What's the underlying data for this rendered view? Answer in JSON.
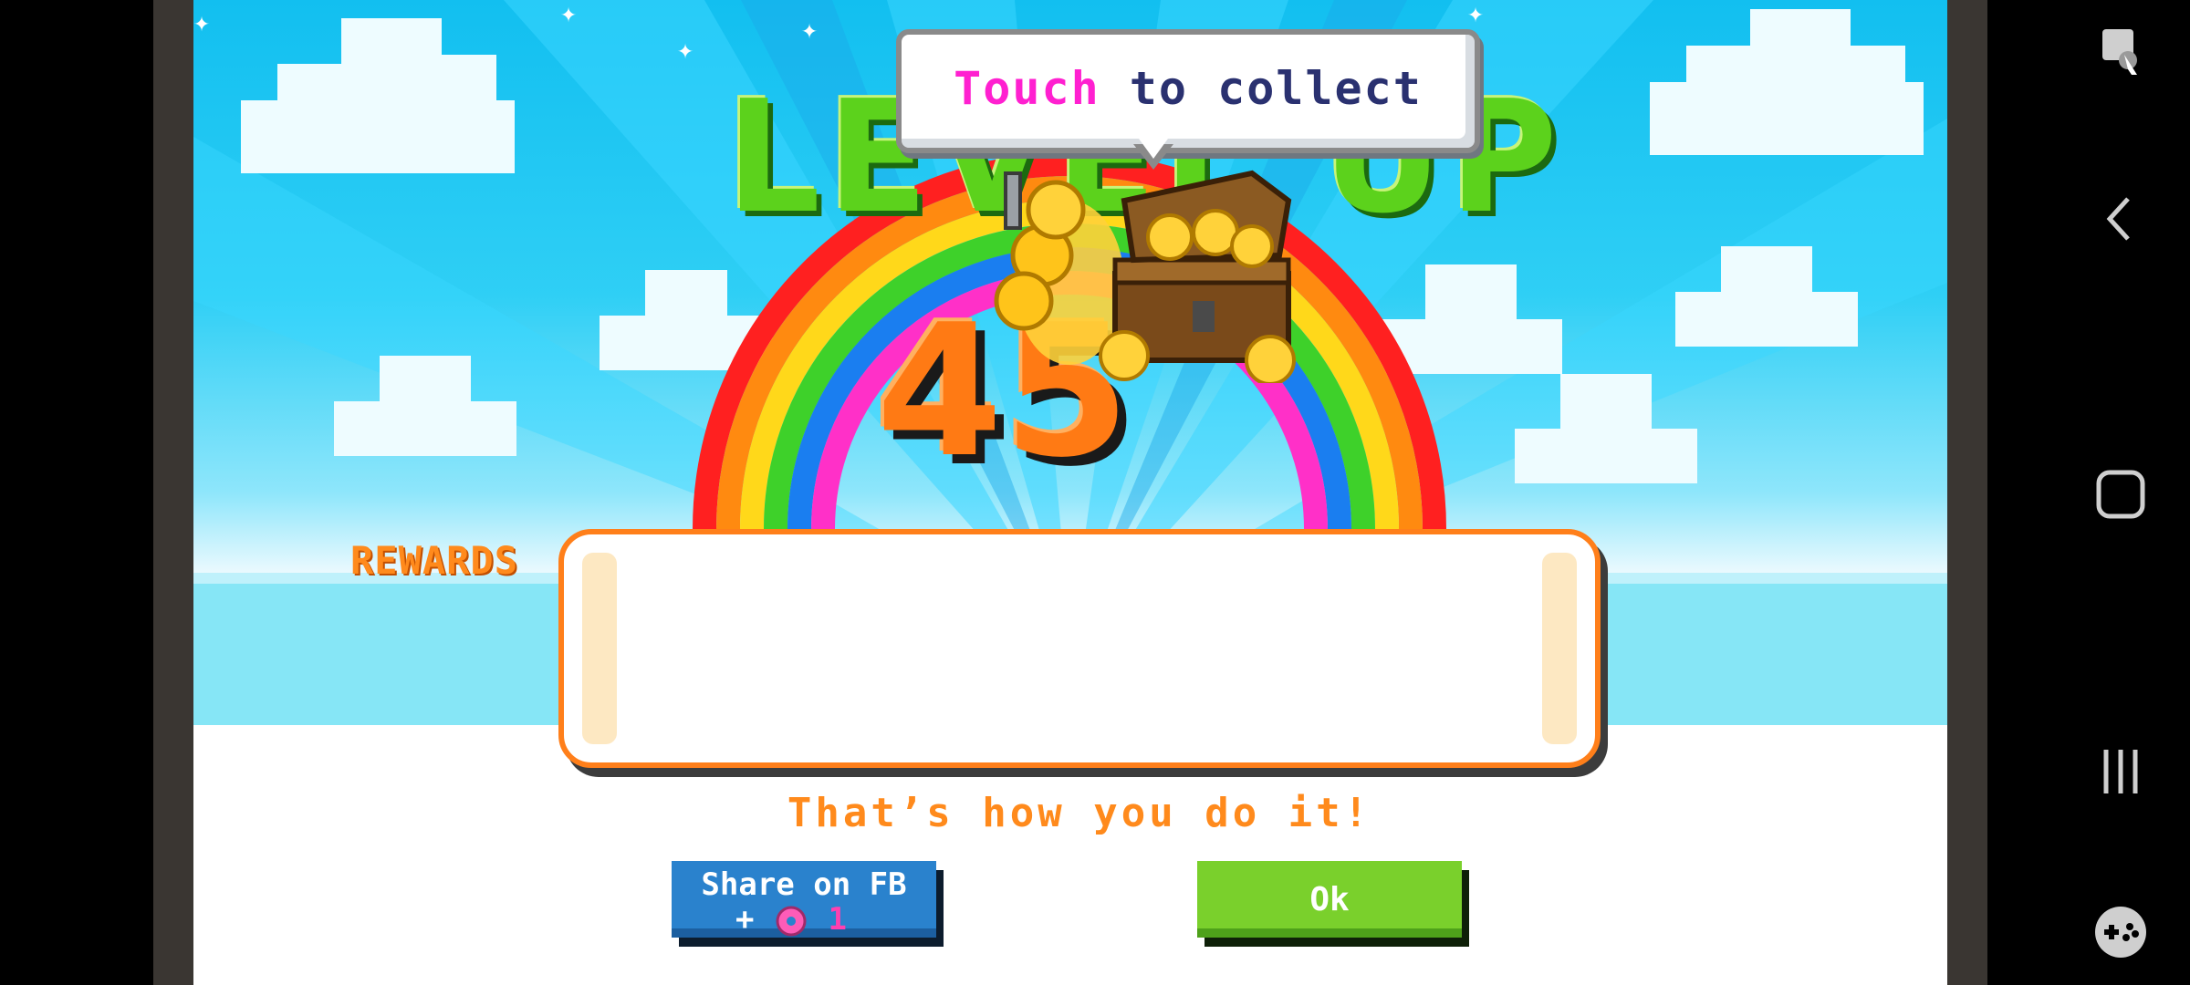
{
  "game": {
    "title_text": "LEVEL UP",
    "level_number": "45",
    "bubble": {
      "highlight": "Touch",
      "rest": " to collect"
    },
    "rewards_label": "REWARDS",
    "tagline": "That’s how you do it!",
    "share_button": {
      "label": "Share on FB",
      "cost_prefix": "+",
      "cost_icon": "donut-icon",
      "cost_value": "1"
    },
    "ok_button": {
      "label": "Ok"
    }
  },
  "colors": {
    "sky": "#12bff0",
    "title_green": "#5cd21c",
    "number_orange": "#ff7a14",
    "highlight_pink": "#ff20d0",
    "accent_orange": "#ff7f1a",
    "share_blue": "#2a82cd",
    "ok_green": "#7ad02c"
  },
  "system_nav": {
    "icons": [
      "screen-touch-icon",
      "back-icon",
      "home-icon",
      "recents-icon",
      "game-tools-icon"
    ]
  }
}
